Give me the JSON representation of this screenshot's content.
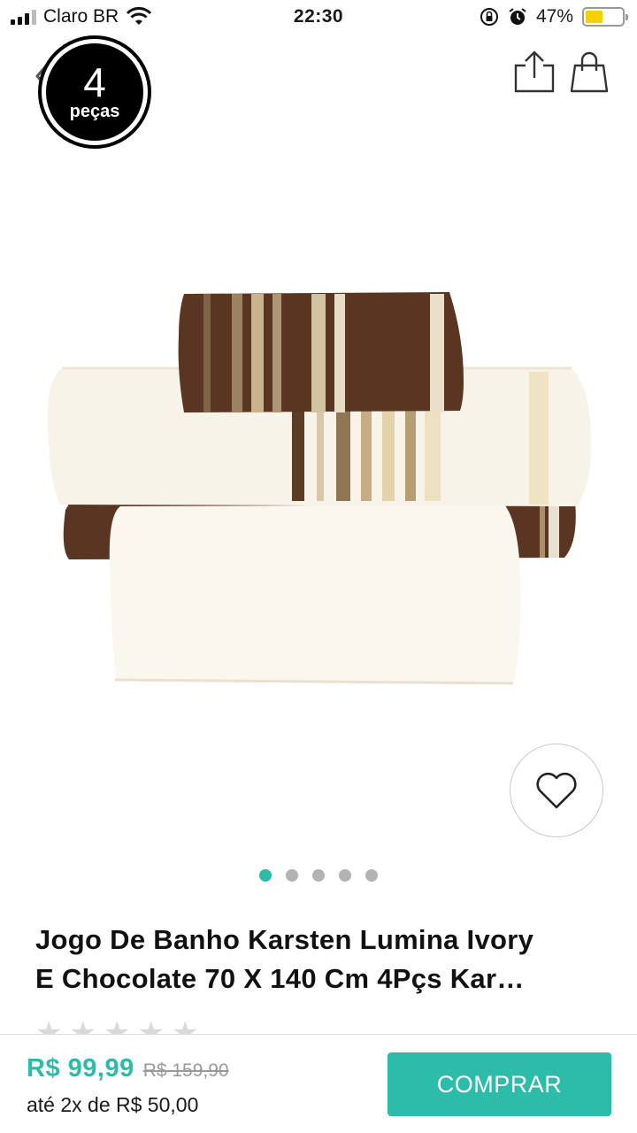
{
  "status_bar": {
    "carrier": "Claro BR",
    "time": "22:30",
    "battery_percent": "47%",
    "battery_level": 0.47,
    "battery_color": "#f5d000",
    "icons": [
      "signal-icon",
      "wifi-icon",
      "orientation-lock-icon",
      "alarm-icon",
      "battery-icon"
    ]
  },
  "header": {
    "badge_number": "4",
    "badge_word": "peças",
    "icons": [
      "back-icon",
      "share-icon",
      "shopping-bag-icon"
    ]
  },
  "gallery": {
    "image_count": 5,
    "active_index": 0,
    "accent_color": "#2dbcaa"
  },
  "product": {
    "title_line1": "Jogo De Banho Karsten Lumina Ivory",
    "title_line2": "E Chocolate 70 X 140 Cm 4Pçs Kar…",
    "rating_stars": 0
  },
  "purchase": {
    "price": "R$  99,99",
    "old_price": "R$  159,90",
    "installment": "até 2x de R$  50,00",
    "buy_label": "COMPRAR"
  }
}
